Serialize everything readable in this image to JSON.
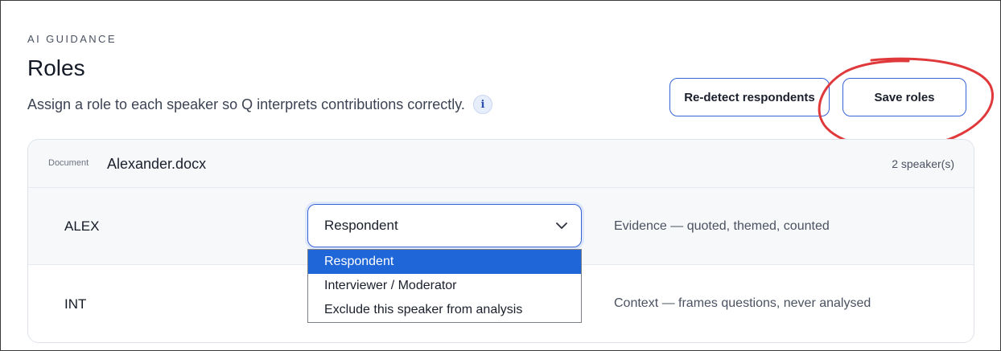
{
  "header": {
    "eyebrow": "AI GUIDANCE",
    "title": "Roles",
    "subtitle": "Assign a role to each speaker so Q interprets contributions correctly.",
    "info_glyph": "i"
  },
  "actions": {
    "redetect_label": "Re-detect respondents",
    "save_label": "Save roles"
  },
  "document": {
    "label": "Document",
    "name": "Alexander.docx",
    "speaker_count": "2 speaker(s)"
  },
  "speakers": [
    {
      "name": "ALEX",
      "role": "Respondent",
      "description": "Evidence — quoted, themed, counted"
    },
    {
      "name": "INT",
      "role": "Interviewer / Moderator",
      "description": "Context — frames questions, never analysed"
    }
  ],
  "role_dropdown": {
    "open": true,
    "selected": "Respondent",
    "options": [
      "Respondent",
      "Interviewer / Moderator",
      "Exclude this speaker from analysis"
    ]
  },
  "colors": {
    "accent": "#3563d6",
    "selected_option": "#1f66d8",
    "annotation": "#e0393b"
  },
  "icons": {
    "info": "info-icon",
    "dropdown": "chevron-down-icon"
  }
}
